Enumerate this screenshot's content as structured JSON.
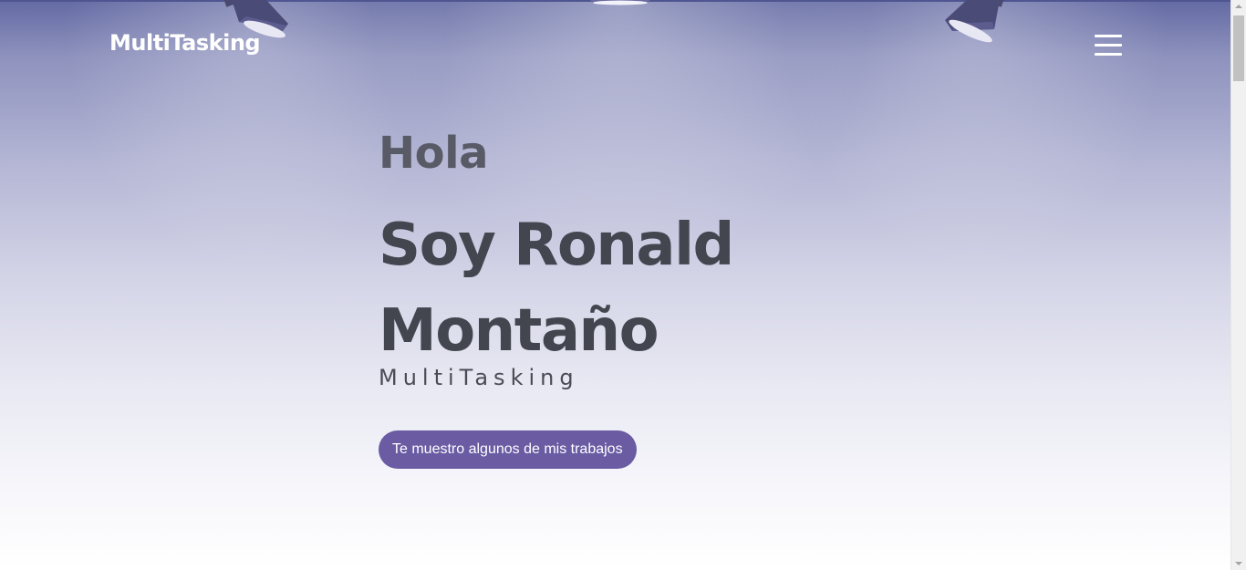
{
  "header": {
    "brand": "MultiTasking",
    "menu_icon": "hamburger-menu-icon"
  },
  "hero": {
    "greeting": "Hola",
    "name_line1": "Soy Ronald",
    "name_line2": "Montaño",
    "subtitle": "MultiTasking",
    "cta_label": "Te muestro algunos de mis trabajos",
    "decor_icons": [
      "spotlight-icon",
      "spotlight-icon",
      "spotlight-icon"
    ]
  },
  "colors": {
    "accent": "#6a5ba3",
    "header_bg_top": "#636aa3",
    "heading_text": "#43464f",
    "greeting_text": "#585a66"
  }
}
